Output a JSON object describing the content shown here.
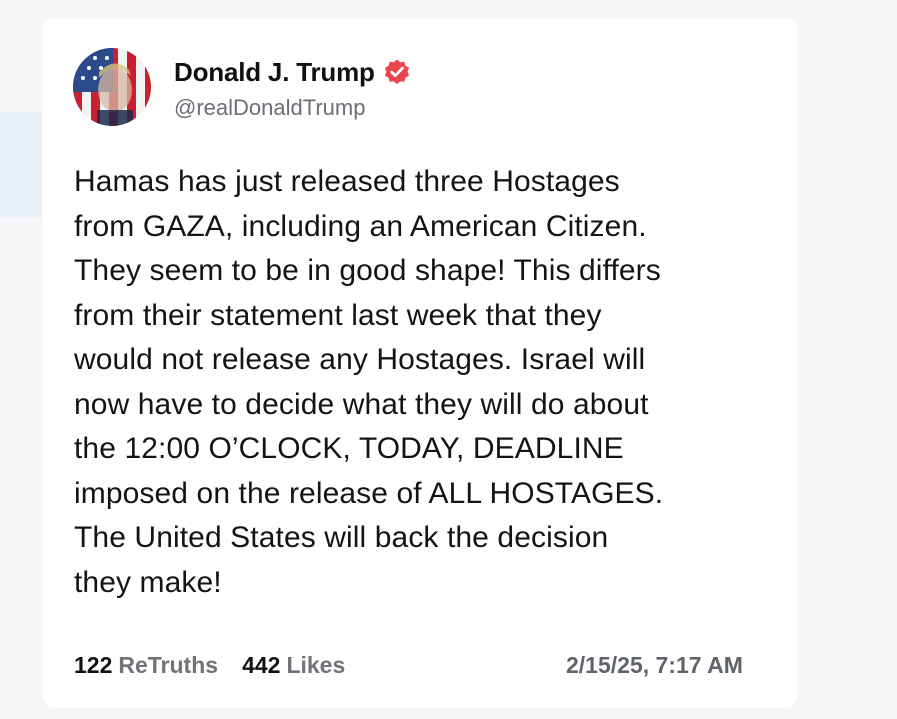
{
  "post": {
    "author": {
      "display_name": "Donald J. Trump",
      "handle": "@realDonaldTrump",
      "verified_icon": "verified-badge-icon",
      "avatar_icon": "flag-portrait-avatar"
    },
    "body_lines": [
      "Hamas has just released three Hostages",
      "from GAZA, including an American Citizen.",
      "They seem to be in good shape! This differs",
      "from their statement last week that they",
      "would not release any Hostages. Israel will",
      "now have to decide what they will do about",
      "the 12:00 O’CLOCK, TODAY, DEADLINE",
      "imposed on the release of ALL HOSTAGES.",
      "The United States will back the decision",
      "they make!"
    ],
    "stats": {
      "retruths_count": "122",
      "retruths_label": "ReTruths",
      "likes_count": "442",
      "likes_label": "Likes"
    },
    "timestamp": "2/15/25, 7:17 AM"
  },
  "colors": {
    "verified_badge": "#e8474f",
    "body_text": "#141414",
    "muted_text": "#6b6f76"
  }
}
